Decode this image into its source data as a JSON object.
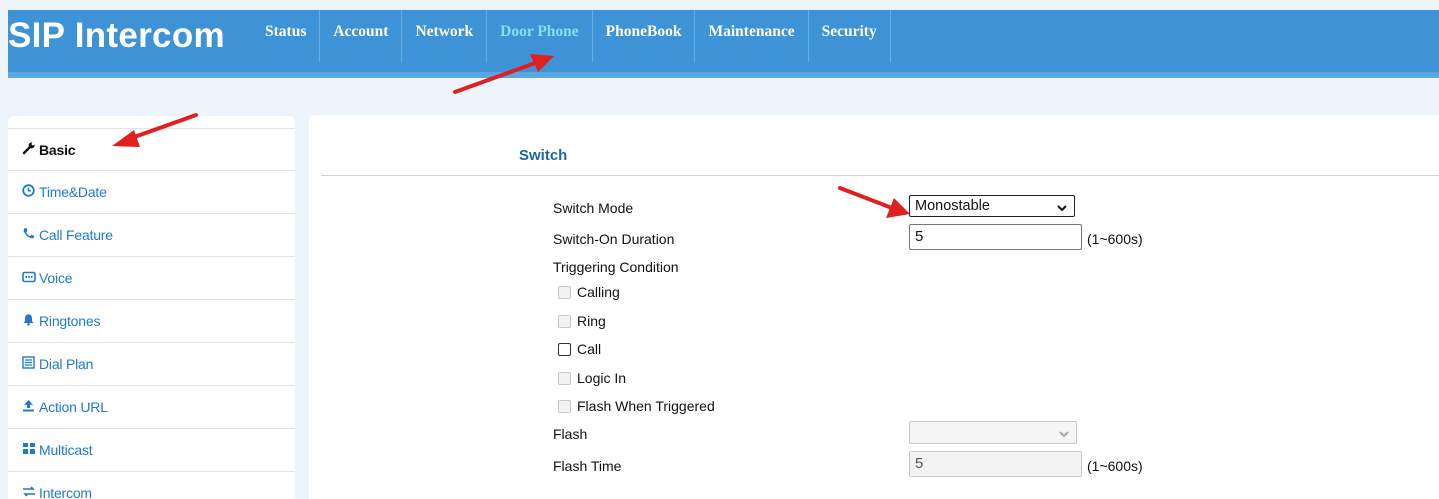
{
  "header": {
    "brand": "SIP Intercom",
    "nav": [
      "Status",
      "Account",
      "Network",
      "Door Phone",
      "PhoneBook",
      "Maintenance",
      "Security"
    ],
    "active_nav": "Door Phone"
  },
  "sidebar": {
    "items": [
      {
        "label": "Basic",
        "icon": "wrench-icon",
        "active": true
      },
      {
        "label": "Time&Date",
        "icon": "clock-icon"
      },
      {
        "label": "Call Feature",
        "icon": "phone-icon"
      },
      {
        "label": "Voice",
        "icon": "voice-icon"
      },
      {
        "label": "Ringtones",
        "icon": "bell-icon"
      },
      {
        "label": "Dial Plan",
        "icon": "list-icon"
      },
      {
        "label": "Action URL",
        "icon": "upload-icon"
      },
      {
        "label": "Multicast",
        "icon": "group-icon"
      },
      {
        "label": "Intercom",
        "icon": "exchange-icon"
      }
    ]
  },
  "main": {
    "section_title": "Switch",
    "switch_mode": {
      "label": "Switch Mode",
      "value": "Monostable"
    },
    "switch_on_duration": {
      "label": "Switch-On Duration",
      "value": "5",
      "hint": "(1~600s)"
    },
    "triggering_condition": {
      "label": "Triggering Condition",
      "options": [
        {
          "label": "Calling",
          "checked": false,
          "enabled": false
        },
        {
          "label": "Ring",
          "checked": false,
          "enabled": false
        },
        {
          "label": "Call",
          "checked": false,
          "enabled": true
        },
        {
          "label": "Logic In",
          "checked": false,
          "enabled": false
        },
        {
          "label": "Flash When Triggered",
          "checked": false,
          "enabled": false
        }
      ]
    },
    "flash": {
      "label": "Flash",
      "value": ""
    },
    "flash_time": {
      "label": "Flash Time",
      "value": "5",
      "hint": "(1~600s)"
    }
  },
  "colors": {
    "header_bg": "#3d93d5",
    "active_nav": "#84e0ee",
    "link": "#1f7ad1",
    "annotation_arrow": "#e02020"
  }
}
